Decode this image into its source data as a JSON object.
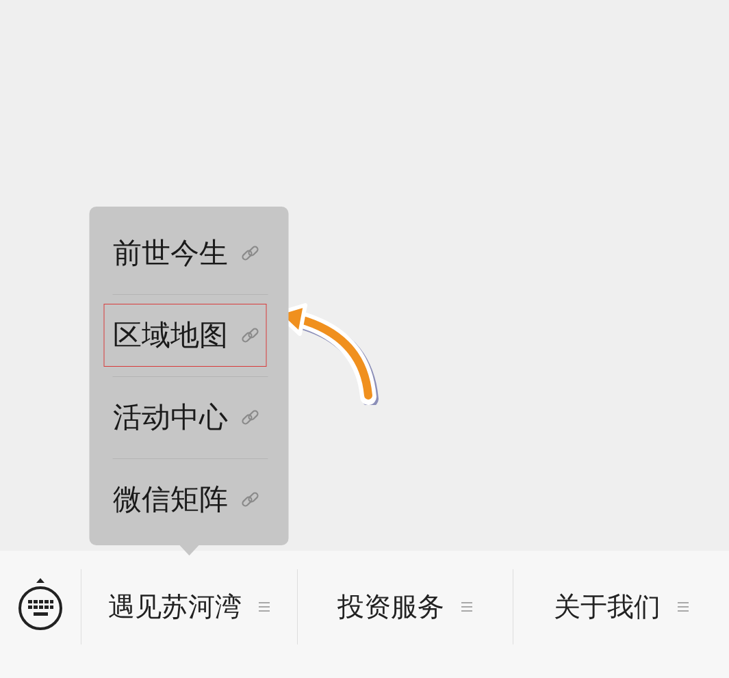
{
  "menu_bar": [
    {
      "label": "遇见苏河湾",
      "submenu": [
        {
          "label": "前世今生",
          "highlighted": false
        },
        {
          "label": "区域地图",
          "highlighted": true
        },
        {
          "label": "活动中心",
          "highlighted": false
        },
        {
          "label": "微信矩阵",
          "highlighted": false
        }
      ]
    },
    {
      "label": "投资服务"
    },
    {
      "label": "关于我们"
    }
  ]
}
